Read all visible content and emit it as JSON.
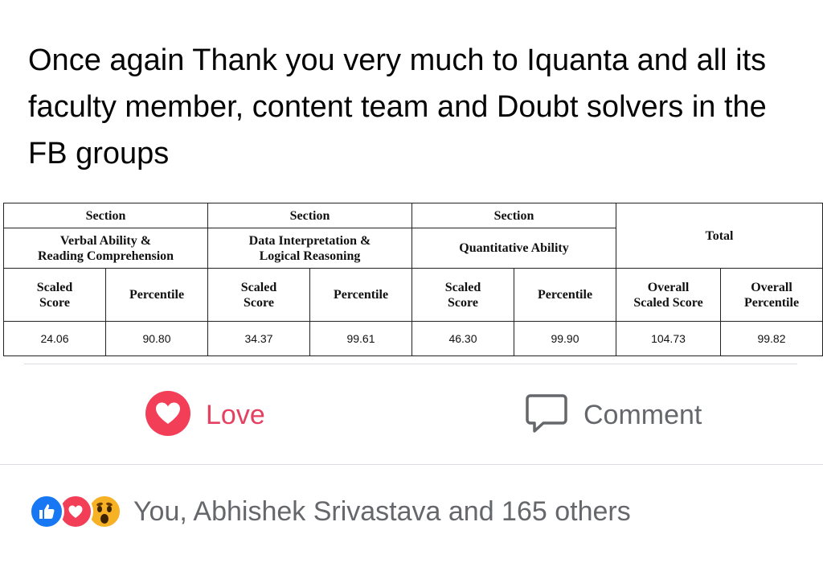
{
  "post": {
    "text": "Once again Thank you very much to Iquanta and all its faculty member, content team and Doubt solvers in the FB groups"
  },
  "score_table": {
    "section_label": "Section",
    "sections": [
      {
        "line1": "Verbal Ability &",
        "line2": "Reading Comprehension"
      },
      {
        "line1": "Data Interpretation &",
        "line2": "Logical Reasoning"
      },
      {
        "line1": "Quantitative Ability",
        "line2": ""
      }
    ],
    "total_label": "Total",
    "sub_headers": {
      "scaled_line1": "Scaled",
      "scaled_line2": "Score",
      "percentile": "Percentile",
      "overall_scaled_line1": "Overall",
      "overall_scaled_line2": "Scaled Score",
      "overall_pct_line1": "Overall",
      "overall_pct_line2": "Percentile"
    },
    "values": {
      "varc_scaled": "24.06",
      "varc_percentile": "90.80",
      "dilr_scaled": "34.37",
      "dilr_percentile": "99.61",
      "qa_scaled": "46.30",
      "qa_percentile": "99.90",
      "overall_scaled": "104.73",
      "overall_percentile": "99.82"
    }
  },
  "actions": {
    "love_label": "Love",
    "comment_label": "Comment"
  },
  "reactions": {
    "icons": [
      "like-icon",
      "heart-icon",
      "wow-icon"
    ],
    "summary": "You, Abhishek Srivastava and 165 others"
  },
  "colors": {
    "love": "#e4405f",
    "like_blue": "#1877f2",
    "heart_red": "#f33e58",
    "wow_yellow": "#f7b125",
    "muted_text": "#65676b"
  }
}
